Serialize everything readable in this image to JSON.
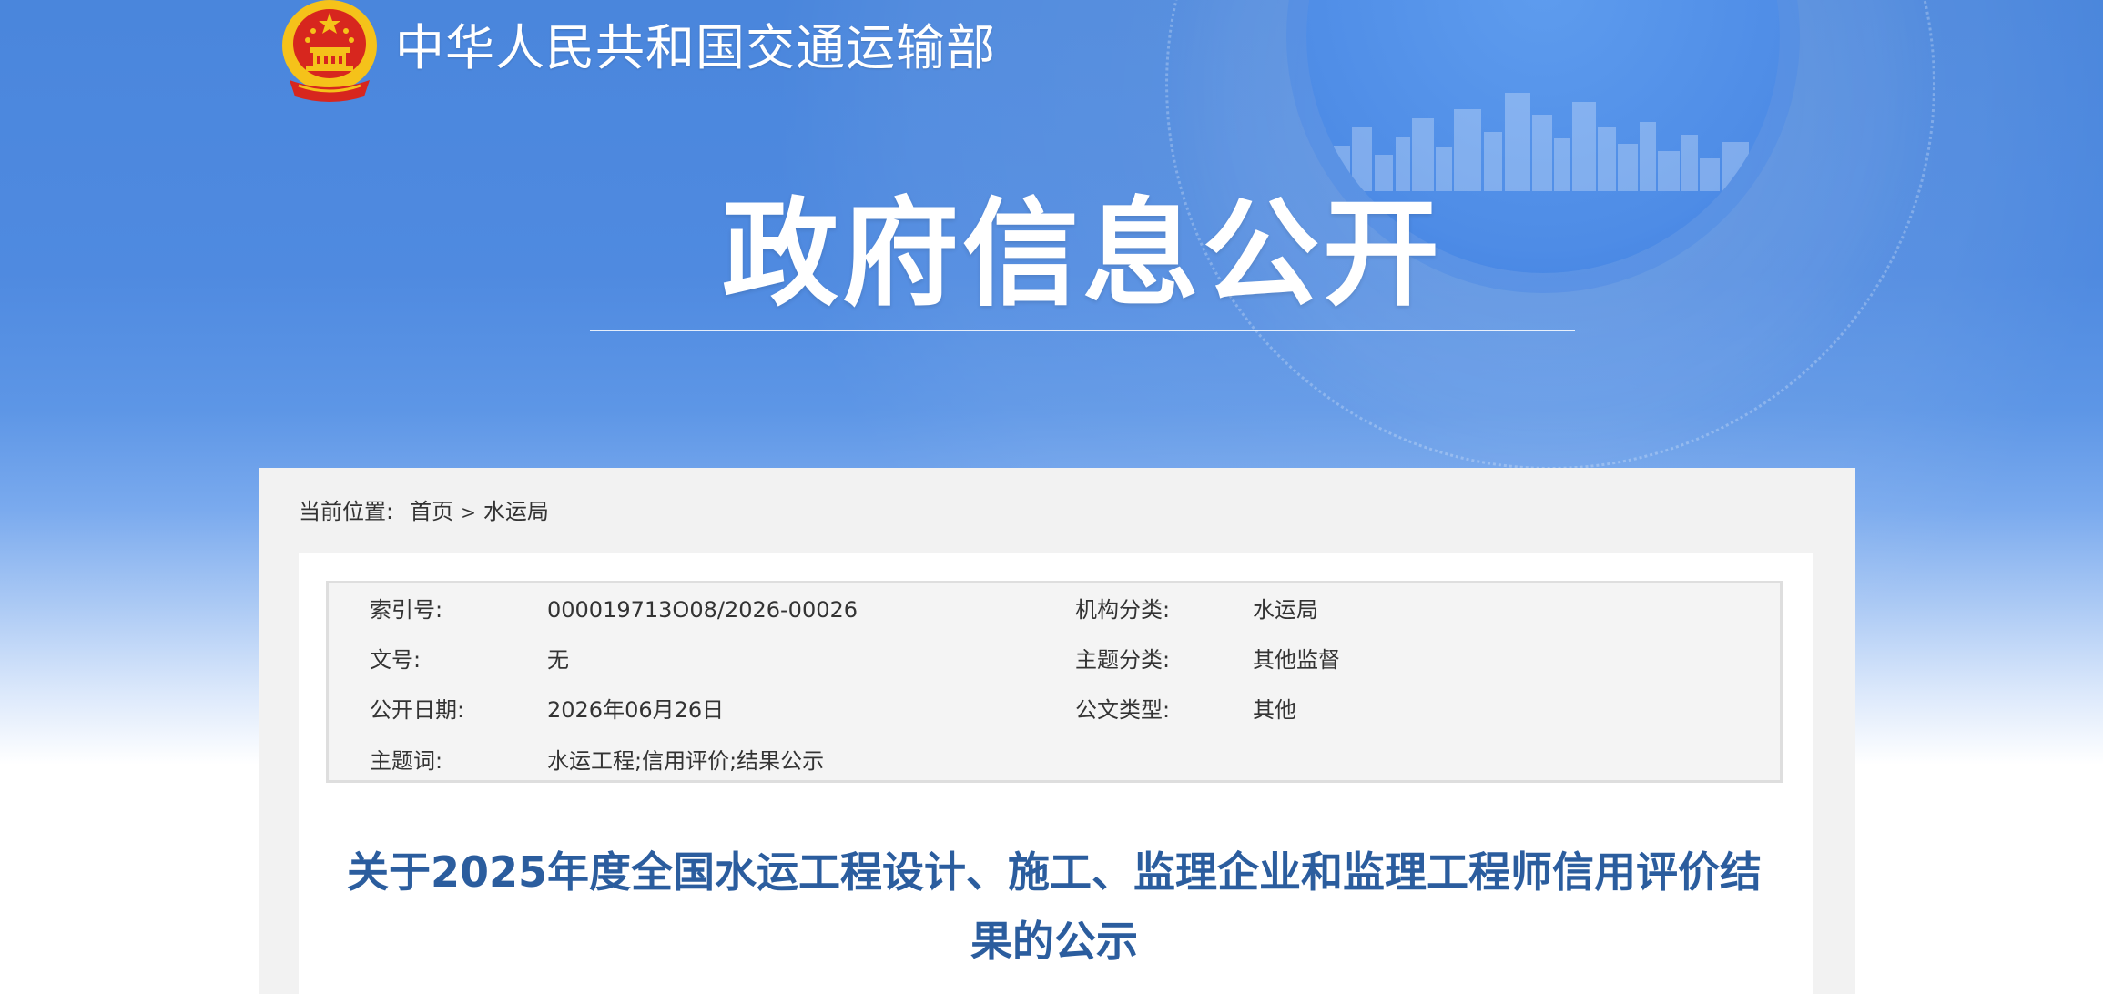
{
  "header": {
    "ministry_name": "中华人民共和国交通运输部",
    "banner_title": "政府信息公开"
  },
  "breadcrumb": {
    "prefix": "当前位置:",
    "items": [
      "首页",
      "水运局"
    ],
    "separator": ">"
  },
  "meta": {
    "index_no": {
      "label": "索引号:",
      "value": "000019713O08/2026-00026"
    },
    "org_category": {
      "label": "机构分类:",
      "value": "水运局"
    },
    "doc_no": {
      "label": "文号:",
      "value": "无"
    },
    "topic_category": {
      "label": "主题分类:",
      "value": "其他监督"
    },
    "publish_date": {
      "label": "公开日期:",
      "value": "2026年06月26日"
    },
    "doc_type": {
      "label": "公文类型:",
      "value": "其他"
    },
    "keywords": {
      "label": "主题词:",
      "value": "水运工程;信用评价;结果公示"
    }
  },
  "document": {
    "title": "关于2025年度全国水运工程设计、施工、监理企业和监理工程师信用评价结果的公示"
  },
  "colors": {
    "banner_blue": "#4a86dc",
    "title_blue": "#2b5d9e",
    "panel_gray": "#f2f2f2",
    "emblem_red": "#d7261e",
    "emblem_gold": "#f5c21a"
  }
}
